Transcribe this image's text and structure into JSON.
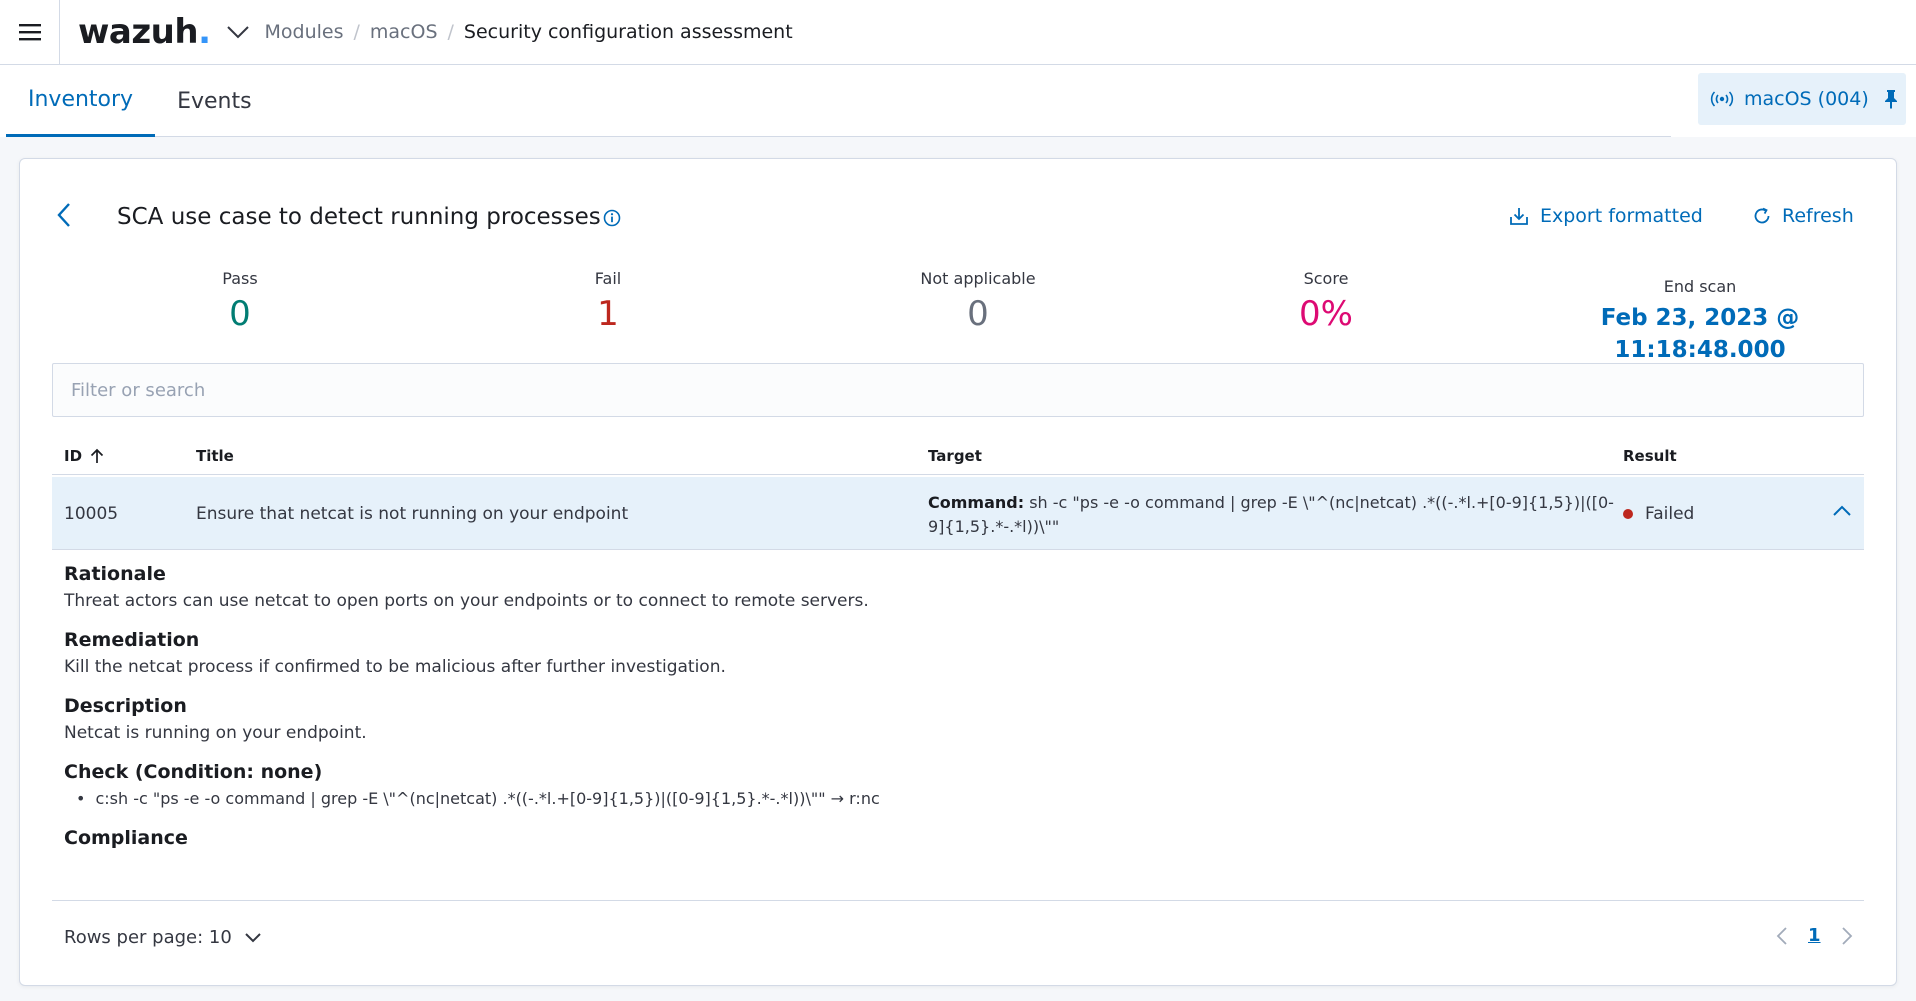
{
  "header": {
    "logo_text": "wazuh",
    "logo_dot": ".",
    "breadcrumbs": [
      "Modules",
      "macOS",
      "Security configuration assessment"
    ]
  },
  "tabs": [
    {
      "label": "Inventory",
      "active": true
    },
    {
      "label": "Events",
      "active": false
    }
  ],
  "agent": {
    "label": "macOS (004)"
  },
  "panel": {
    "title": "SCA use case to detect running processes",
    "export_label": "Export formatted",
    "refresh_label": "Refresh"
  },
  "stats": {
    "pass": {
      "label": "Pass",
      "value": "0"
    },
    "fail": {
      "label": "Fail",
      "value": "1"
    },
    "not_applicable": {
      "label": "Not applicable",
      "value": "0"
    },
    "score": {
      "label": "Score",
      "value": "0%"
    },
    "end_scan": {
      "label": "End scan",
      "value": "Feb 23, 2023 @ 11:18:48.000"
    }
  },
  "search": {
    "placeholder": "Filter or search",
    "value": ""
  },
  "table": {
    "columns": [
      "ID",
      "Title",
      "Target",
      "Result"
    ],
    "rows": [
      {
        "id": "10005",
        "title": "Ensure that netcat is not running on your endpoint",
        "target_label": "Command:",
        "target_value": " sh -c \"ps -e -o command | grep -E \\\"^(nc|netcat) .*((-.*l.+[0-9]{1,5})|([0-9]{1,5}.*-.*l))\\\"\"",
        "result": "Failed"
      }
    ]
  },
  "details": {
    "rationale_heading": "Rationale",
    "rationale_text": "Threat actors can use netcat to open ports on your endpoints or to connect to remote servers.",
    "remediation_heading": "Remediation",
    "remediation_text": "Kill the netcat process if confirmed to be malicious after further investigation.",
    "description_heading": "Description",
    "description_text": "Netcat is running on your endpoint.",
    "check_heading": "Check (Condition: none)",
    "check_item": "c:sh -c \"ps -e -o command | grep -E \\\"^(nc|netcat) .*((-.*l.+[0-9]{1,5})|([0-9]{1,5}.*-.*l))\\\"\" → r:nc",
    "compliance_heading": "Compliance"
  },
  "pagination": {
    "rows_per_page": "Rows per page: 10",
    "current_page": "1"
  },
  "colors": {
    "accent": "#006bb8",
    "pass": "#017d73",
    "fail": "#bd271e",
    "score": "#dd0a73",
    "selected_row": "#e6f1fa"
  },
  "icons": [
    "menu-icon",
    "chevron-down-icon",
    "antenna-icon",
    "pin-icon",
    "arrow-left-icon",
    "info-icon",
    "export-icon",
    "refresh-icon",
    "sort-up-icon",
    "chevron-up-icon",
    "arrow-right-icon"
  ]
}
